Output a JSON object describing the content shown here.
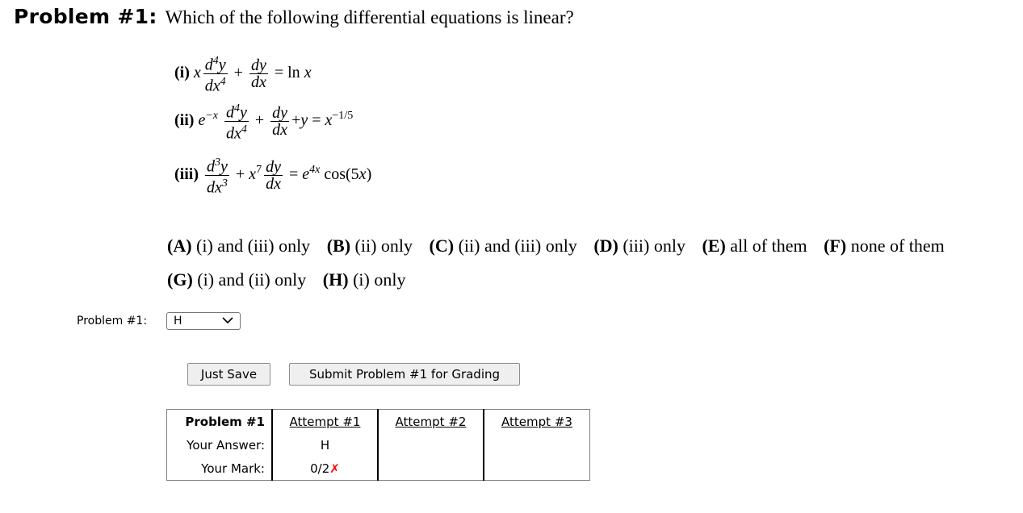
{
  "header": {
    "problem_tag": "Problem #1:",
    "question": "Which of the following differential equations is linear?"
  },
  "equations": [
    {
      "label": "(i)"
    },
    {
      "label": "(ii)"
    },
    {
      "label": "(iii)"
    }
  ],
  "math": {
    "d": "d",
    "y": "y",
    "dx": "dx",
    "x": "x",
    "e": "e",
    "four": "4",
    "three": "3",
    "seven": "7",
    "plus": "+",
    "equals": "=",
    "ln": "ln",
    "neg_x": "−x",
    "x_exp": "−1/5",
    "e_exp": "4x",
    "cos": "cos(5",
    "close": ")"
  },
  "options": [
    {
      "letter": "(A)",
      "text": "(i) and (iii) only"
    },
    {
      "letter": "(B)",
      "text": "(ii) only"
    },
    {
      "letter": "(C)",
      "text": "(ii) and (iii) only"
    },
    {
      "letter": "(D)",
      "text": "(iii) only"
    },
    {
      "letter": "(E)",
      "text": "all of them"
    },
    {
      "letter": "(F)",
      "text": "none of them"
    },
    {
      "letter": "(G)",
      "text": "(i) and (ii) only"
    },
    {
      "letter": "(H)",
      "text": "(i) only"
    }
  ],
  "answer": {
    "label": "Problem #1:",
    "selected": "H",
    "chevron_icon": "⌄"
  },
  "buttons": {
    "save": "Just Save",
    "submit": "Submit Problem #1 for Grading"
  },
  "attempts": {
    "header": "Problem #1",
    "columns": [
      "Attempt #1",
      "Attempt #2",
      "Attempt #3"
    ],
    "row_answer_label": "Your Answer:",
    "row_mark_label": "Your Mark:",
    "answers": [
      "H",
      "",
      ""
    ],
    "marks": [
      "0/2",
      "",
      ""
    ],
    "wrong_icon": "✗"
  }
}
